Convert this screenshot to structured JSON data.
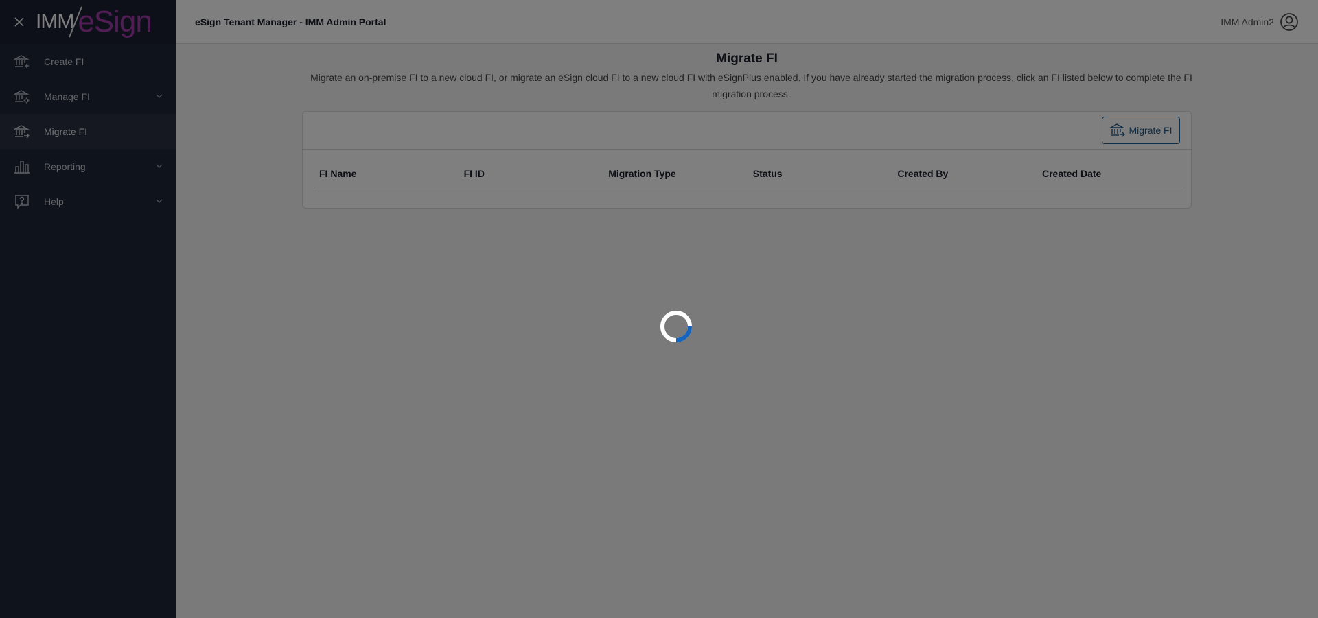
{
  "app": {
    "title": "eSign Tenant Manager - IMM Admin Portal",
    "logo": {
      "part1": "IMM",
      "part2": "eSign"
    },
    "colors": {
      "sidebar": "#1f2636",
      "accent": "#1e5a8a",
      "logo_purple": "#a03aa8"
    }
  },
  "user": {
    "name": "IMM Admin2",
    "icon": "user-circle-icon"
  },
  "sidebar": {
    "close_icon": "close-icon",
    "items": [
      {
        "label": "Create FI",
        "icon": "bank-plus-icon",
        "expandable": false,
        "active": false
      },
      {
        "label": "Manage FI",
        "icon": "bank-gear-icon",
        "expandable": true,
        "active": false
      },
      {
        "label": "Migrate FI",
        "icon": "bank-arrow-icon",
        "expandable": false,
        "active": true
      },
      {
        "label": "Reporting",
        "icon": "bar-chart-icon",
        "expandable": true,
        "active": false
      },
      {
        "label": "Help",
        "icon": "help-icon",
        "expandable": true,
        "active": false
      }
    ]
  },
  "page": {
    "title": "Migrate FI",
    "description": "Migrate an on-premise FI to a new cloud FI, or migrate an eSign cloud FI to a new cloud FI with eSignPlus enabled. If you have already started the migration process, click an FI listed below to complete the FI migration process."
  },
  "toolbar": {
    "migrate_label": "Migrate FI",
    "migrate_icon": "bank-arrow-icon"
  },
  "table": {
    "columns": [
      "FI Name",
      "FI ID",
      "Migration Type",
      "Status",
      "Created By",
      "Created Date"
    ],
    "rows": []
  },
  "loading": {
    "visible": true,
    "icon": "loading-spinner-icon"
  }
}
